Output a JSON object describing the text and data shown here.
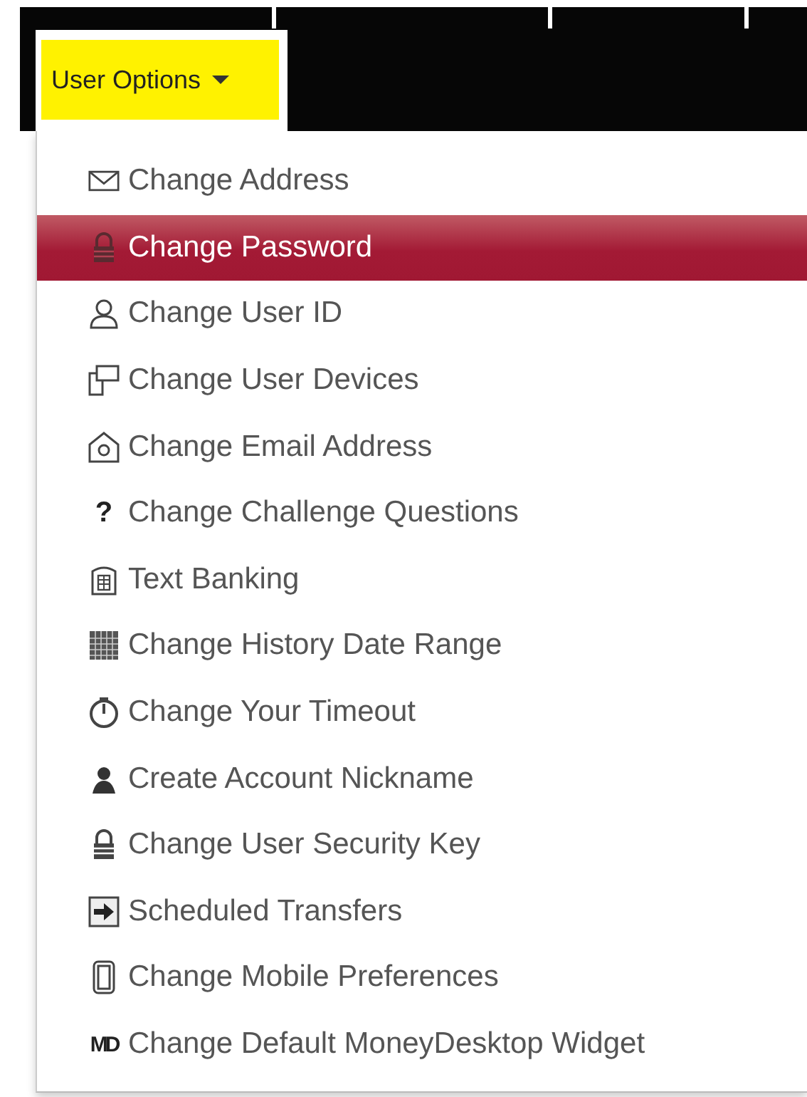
{
  "menu_button": {
    "label": "User Options",
    "expanded": true
  },
  "menu_items": [
    {
      "label": "Change Address",
      "kind": "envelope",
      "selected": false
    },
    {
      "label": "Change Password",
      "kind": "padlock",
      "selected": true
    },
    {
      "label": "Change User ID",
      "kind": "user",
      "selected": false
    },
    {
      "label": "Change User Devices",
      "kind": "devices",
      "selected": false
    },
    {
      "label": "Change Email Address",
      "kind": "at-house",
      "selected": false
    },
    {
      "label": "Change Challenge Questions",
      "kind": "question",
      "selected": false,
      "glyph": "?"
    },
    {
      "label": "Text Banking",
      "kind": "phone-keypad",
      "selected": false
    },
    {
      "label": "Change History Date Range",
      "kind": "calendar",
      "selected": false
    },
    {
      "label": "Change Your Timeout",
      "kind": "stopwatch",
      "selected": false
    },
    {
      "label": "Create Account Nickname",
      "kind": "person",
      "selected": false
    },
    {
      "label": "Change User Security Key",
      "kind": "padlock",
      "selected": false
    },
    {
      "label": "Scheduled Transfers",
      "kind": "transfer",
      "selected": false
    },
    {
      "label": "Change Mobile Preferences",
      "kind": "mobile",
      "selected": false
    },
    {
      "label": "Change Default MoneyDesktop Widget",
      "kind": "logo",
      "selected": false,
      "glyph": "MD"
    }
  ]
}
